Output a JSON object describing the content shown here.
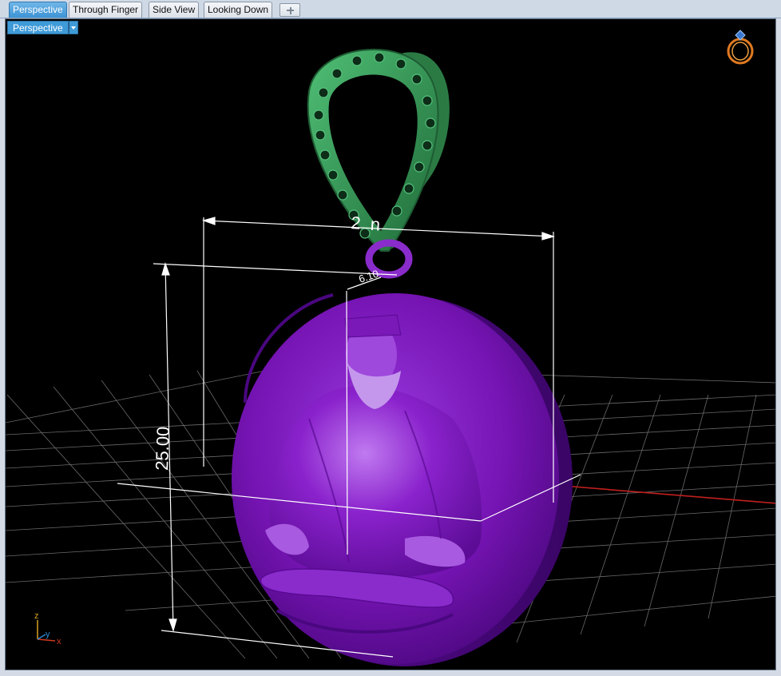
{
  "tabs": [
    {
      "label": "Perspective",
      "active": true
    },
    {
      "label": "Through Finger",
      "active": false
    },
    {
      "label": "Side View",
      "active": false
    },
    {
      "label": "Looking Down",
      "active": false
    }
  ],
  "viewport": {
    "title": "Perspective",
    "dimensions": {
      "height_label": "25.00",
      "width_label": "2  n",
      "bail_label": "6.10"
    },
    "axes": {
      "z": "z",
      "y": "y",
      "x": "x"
    }
  },
  "colors": {
    "pendant": "#7a16b8",
    "bail": "#2f8a4c",
    "grid": "#8a8a8a",
    "x_axis": "#c0201e",
    "tab_active": "#3f9ad8",
    "background": "#000000"
  },
  "icons": [
    "add-tab-icon",
    "dropdown-icon",
    "ring-view-icon",
    "axis-gizmo-icon"
  ]
}
